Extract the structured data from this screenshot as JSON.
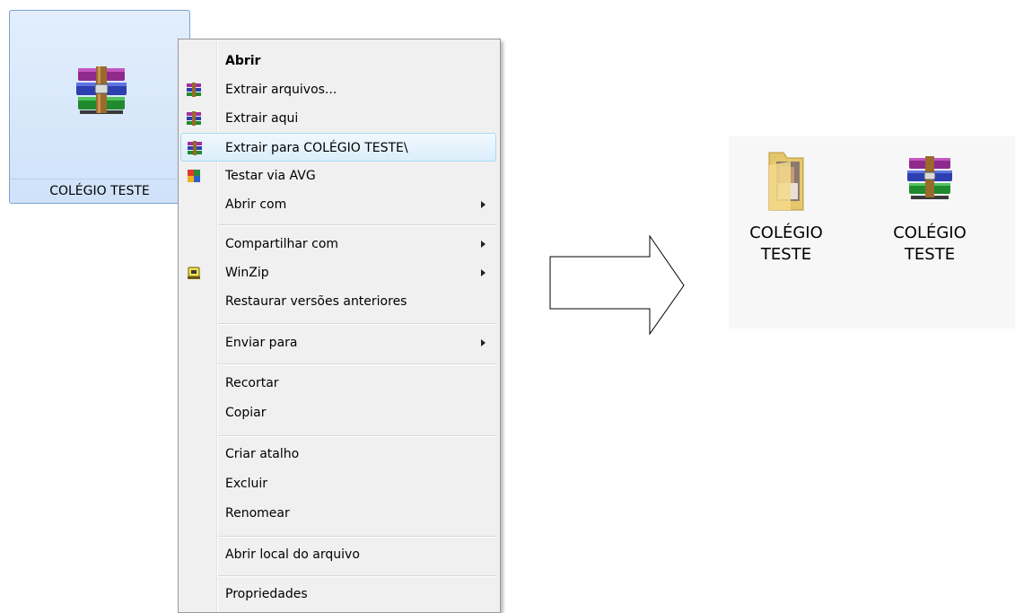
{
  "file": {
    "name": "COLÉGIO TESTE",
    "icon": "winrar-archive-icon"
  },
  "context_menu": {
    "items": [
      {
        "label": "Abrir",
        "bold": true
      },
      {
        "label": "Extrair arquivos...",
        "icon": "winrar-icon"
      },
      {
        "label": "Extrair aqui",
        "icon": "winrar-icon"
      },
      {
        "label": "Extrair para COLÉGIO TESTE\\",
        "icon": "winrar-icon",
        "highlighted": true
      },
      {
        "label": "Testar via  AVG",
        "icon": "avg-icon"
      },
      {
        "label": "Abrir com",
        "submenu": true
      },
      {
        "label": "Compartilhar com",
        "submenu": true
      },
      {
        "label": "WinZip",
        "icon": "winzip-icon",
        "submenu": true
      },
      {
        "label": "Restaurar versões anteriores"
      },
      {
        "label": "Enviar para",
        "submenu": true
      },
      {
        "label": "Recortar"
      },
      {
        "label": "Copiar"
      },
      {
        "label": "Criar atalho"
      },
      {
        "label": "Excluir"
      },
      {
        "label": "Renomear"
      },
      {
        "label": "Abrir local do arquivo"
      },
      {
        "label": "Propriedades"
      }
    ]
  },
  "result": {
    "folder": {
      "line1": "COLÉGIO",
      "line2": "TESTE",
      "icon": "folder-icon"
    },
    "archive": {
      "line1": "COLÉGIO",
      "line2": "TESTE",
      "icon": "winrar-archive-icon"
    }
  },
  "colors": {
    "selection_border": "#7da2ce",
    "menu_bg": "#f0f0f0",
    "hover_border": "#a8d8f5"
  }
}
